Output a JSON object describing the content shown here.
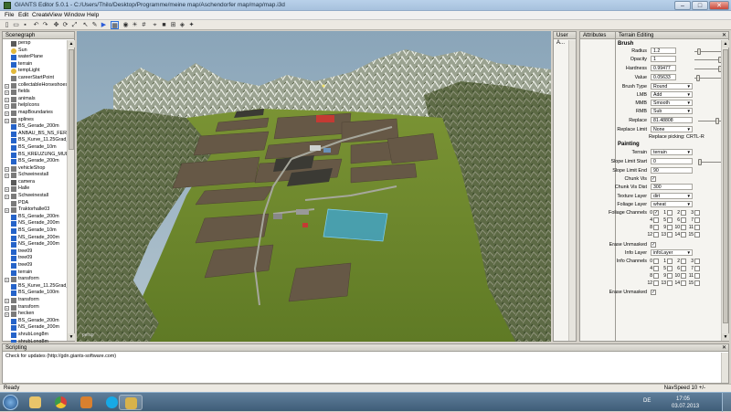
{
  "window": {
    "title": "GIANTS Editor 5.0.1 - C:/Users/Thilo/Desktop/Programme/meine map/Aschendorfer map/map/map.i3d",
    "minimize": "–",
    "maximize": "□",
    "close": "✕"
  },
  "menu": [
    "File",
    "Edit",
    "Create",
    "View",
    "Window",
    "Help"
  ],
  "toolbar_icons": [
    "new-icon",
    "open-icon",
    "save-icon",
    "undo-icon",
    "redo-icon",
    "move-icon",
    "rotate-icon",
    "scale-icon",
    "select-icon",
    "select-icon",
    "terrain-icon",
    "camera-icon",
    "light-icon",
    "grid-icon",
    "snap-icon",
    "play-icon",
    "stop-icon",
    "sun-icon",
    "nav-icon",
    "measure-icon"
  ],
  "scenegraph": {
    "title": "Scenegraph",
    "items": [
      {
        "label": "persp",
        "icon": "camera",
        "exp": false
      },
      {
        "label": "Sun",
        "icon": "light",
        "exp": false
      },
      {
        "label": "waterPlane",
        "icon": "shape",
        "exp": false
      },
      {
        "label": "terrain",
        "icon": "shape",
        "exp": false
      },
      {
        "label": "tempLight",
        "icon": "light",
        "exp": false
      },
      {
        "label": "careerStartPoint",
        "icon": "transform",
        "exp": false
      },
      {
        "label": "collectableHorseshoes",
        "icon": "transform",
        "exp": true
      },
      {
        "label": "fields",
        "icon": "transform",
        "exp": true
      },
      {
        "label": "animals",
        "icon": "transform",
        "exp": true
      },
      {
        "label": "helpIcons",
        "icon": "transform",
        "exp": true
      },
      {
        "label": "mapBoundaries",
        "icon": "transform",
        "exp": true
      },
      {
        "label": "splines",
        "icon": "transform",
        "exp": true
      },
      {
        "label": "BS_Gerade_200m",
        "icon": "shape",
        "exp": false
      },
      {
        "label": "ANBAU_BS_NS_FERTIG",
        "icon": "shape",
        "exp": false
      },
      {
        "label": "BS_Kurve_11.25Grad_16",
        "icon": "shape",
        "exp": false
      },
      {
        "label": "BS_Gerade_10m",
        "icon": "shape",
        "exp": false
      },
      {
        "label": "BS_KREUZUNG_MULTI_",
        "icon": "shape",
        "exp": false
      },
      {
        "label": "BS_Gerade_200m",
        "icon": "shape",
        "exp": false
      },
      {
        "label": "vehicleShop",
        "icon": "transform",
        "exp": true
      },
      {
        "label": "Schweinestall",
        "icon": "transform",
        "exp": true
      },
      {
        "label": "camera",
        "icon": "camera",
        "exp": false
      },
      {
        "label": "Halle",
        "icon": "transform",
        "exp": true
      },
      {
        "label": "Schweinestall",
        "icon": "transform",
        "exp": true
      },
      {
        "label": "PDA",
        "icon": "transform",
        "exp": false
      },
      {
        "label": "Traktorhalle03",
        "icon": "transform",
        "exp": true
      },
      {
        "label": "BS_Gerade_200m",
        "icon": "shape",
        "exp": false
      },
      {
        "label": "NS_Gerade_200m",
        "icon": "shape",
        "exp": false
      },
      {
        "label": "BS_Gerade_10m",
        "icon": "shape",
        "exp": false
      },
      {
        "label": "NS_Gerade_200m",
        "icon": "shape",
        "exp": false
      },
      {
        "label": "NS_Gerade_200m",
        "icon": "shape",
        "exp": false
      },
      {
        "label": "tree09",
        "icon": "shape",
        "exp": false
      },
      {
        "label": "tree09",
        "icon": "shape",
        "exp": false
      },
      {
        "label": "tree09",
        "icon": "shape",
        "exp": false
      },
      {
        "label": "terrain",
        "icon": "shape",
        "exp": false
      },
      {
        "label": "transform",
        "icon": "transform",
        "exp": true
      },
      {
        "label": "BS_Kurve_11.25Grad_16(",
        "icon": "shape",
        "exp": false
      },
      {
        "label": "BS_Gerade_100m",
        "icon": "shape",
        "exp": false
      },
      {
        "label": "transform",
        "icon": "transform",
        "exp": true
      },
      {
        "label": "transform",
        "icon": "transform",
        "exp": true
      },
      {
        "label": "hecken",
        "icon": "transform",
        "exp": true
      },
      {
        "label": "BS_Gerade_200m",
        "icon": "shape",
        "exp": false
      },
      {
        "label": "NS_Gerade_200m",
        "icon": "shape",
        "exp": false
      },
      {
        "label": "shrubLong8m",
        "icon": "shape",
        "exp": false
      },
      {
        "label": "shrubLong8m",
        "icon": "shape",
        "exp": false
      }
    ]
  },
  "viewport": {
    "camera_label": "persp"
  },
  "user_attributes": {
    "title": "User A...",
    "close": "✕"
  },
  "attributes": {
    "title": "Attributes",
    "close": "✕"
  },
  "terrain_editing": {
    "title": "Terrain Editing",
    "close": "✕",
    "brush_section": "Brush",
    "radius_label": "Radius",
    "radius_value": "1.2",
    "radius_slider": 0.1,
    "opacity_label": "Opacity",
    "opacity_value": "1",
    "opacity_slider": 1.0,
    "hardness_label": "Hardness",
    "hardness_value": "0.99477",
    "hardness_slider": 0.99,
    "value_label": "Value",
    "value_value": "0.05633",
    "value_slider": 0.06,
    "brush_type_label": "Brush Type",
    "brush_type_value": "Round",
    "lmb_label": "LMB",
    "lmb_value": "Add",
    "mmb_label": "MMB",
    "mmb_value": "Smooth",
    "rmb_label": "RMB",
    "rmb_value": "Sub",
    "replace_label": "Replace",
    "replace_value": "81.48808",
    "replace_slider": 0.8,
    "replace_limit_label": "Replace Limit",
    "replace_limit_value": "None",
    "replace_picking": "Replace picking: CRTL-R",
    "painting_section": "Painting",
    "terrain_label": "Terrain",
    "terrain_value": "terrain",
    "slope_start_label": "Slope Limit Start",
    "slope_start_value": "0",
    "slope_start_slider": 0.0,
    "slope_end_label": "Slope Limit End",
    "slope_end_value": "90",
    "chunk_vis_label": "Chunk Vis",
    "chunk_vis_checked": "✓",
    "chunk_vis_dist_label": "Chunk Vis Dist",
    "chunk_vis_dist_value": "300",
    "texture_layer_label": "Texture Layer",
    "texture_layer_value": "dirt",
    "foliage_layer_label": "Foliage Layer",
    "foliage_layer_value": "wheat",
    "foliage_channels_label": "Foliage Channels",
    "foliage_channels": [
      "0",
      "1",
      "2",
      "3",
      "4",
      "5",
      "6",
      "7",
      "8",
      "9",
      "10",
      "11",
      "12",
      "13",
      "14",
      "15"
    ],
    "foliage_checked": [
      0
    ],
    "erase_unmasked_label": "Erase Unmasked",
    "erase_unmasked_checked": "✓",
    "info_layer_label": "Info Layer",
    "info_layer_value": "infoLayer",
    "info_channels_label": "Info Channels",
    "info_channels": [
      "0",
      "1",
      "2",
      "3",
      "4",
      "5",
      "6",
      "7",
      "8",
      "9",
      "10",
      "11",
      "12",
      "13",
      "14",
      "15"
    ],
    "info_checked": [],
    "erase_unmasked2_label": "Erase Unmasked",
    "erase_unmasked2_checked": "✓"
  },
  "scripting": {
    "title": "Scripting",
    "close": "✕",
    "output": "Check for updates (http://gdn.giants-software.com)"
  },
  "status": {
    "left": "Ready",
    "right": "NavSpeed 10 +/-"
  },
  "taskbar": {
    "language": "DE",
    "time": "17:05",
    "date": "03.07.2013",
    "apps": [
      "windows-start",
      "explorer",
      "media-player",
      "chrome",
      "media",
      "photoshop",
      "skype",
      "giants-editor"
    ]
  },
  "colors": {
    "grass": "#6e8a2c",
    "field_brown": "#665846",
    "selection_blue": "#3da7d8",
    "sky": "#9eb6c7"
  }
}
